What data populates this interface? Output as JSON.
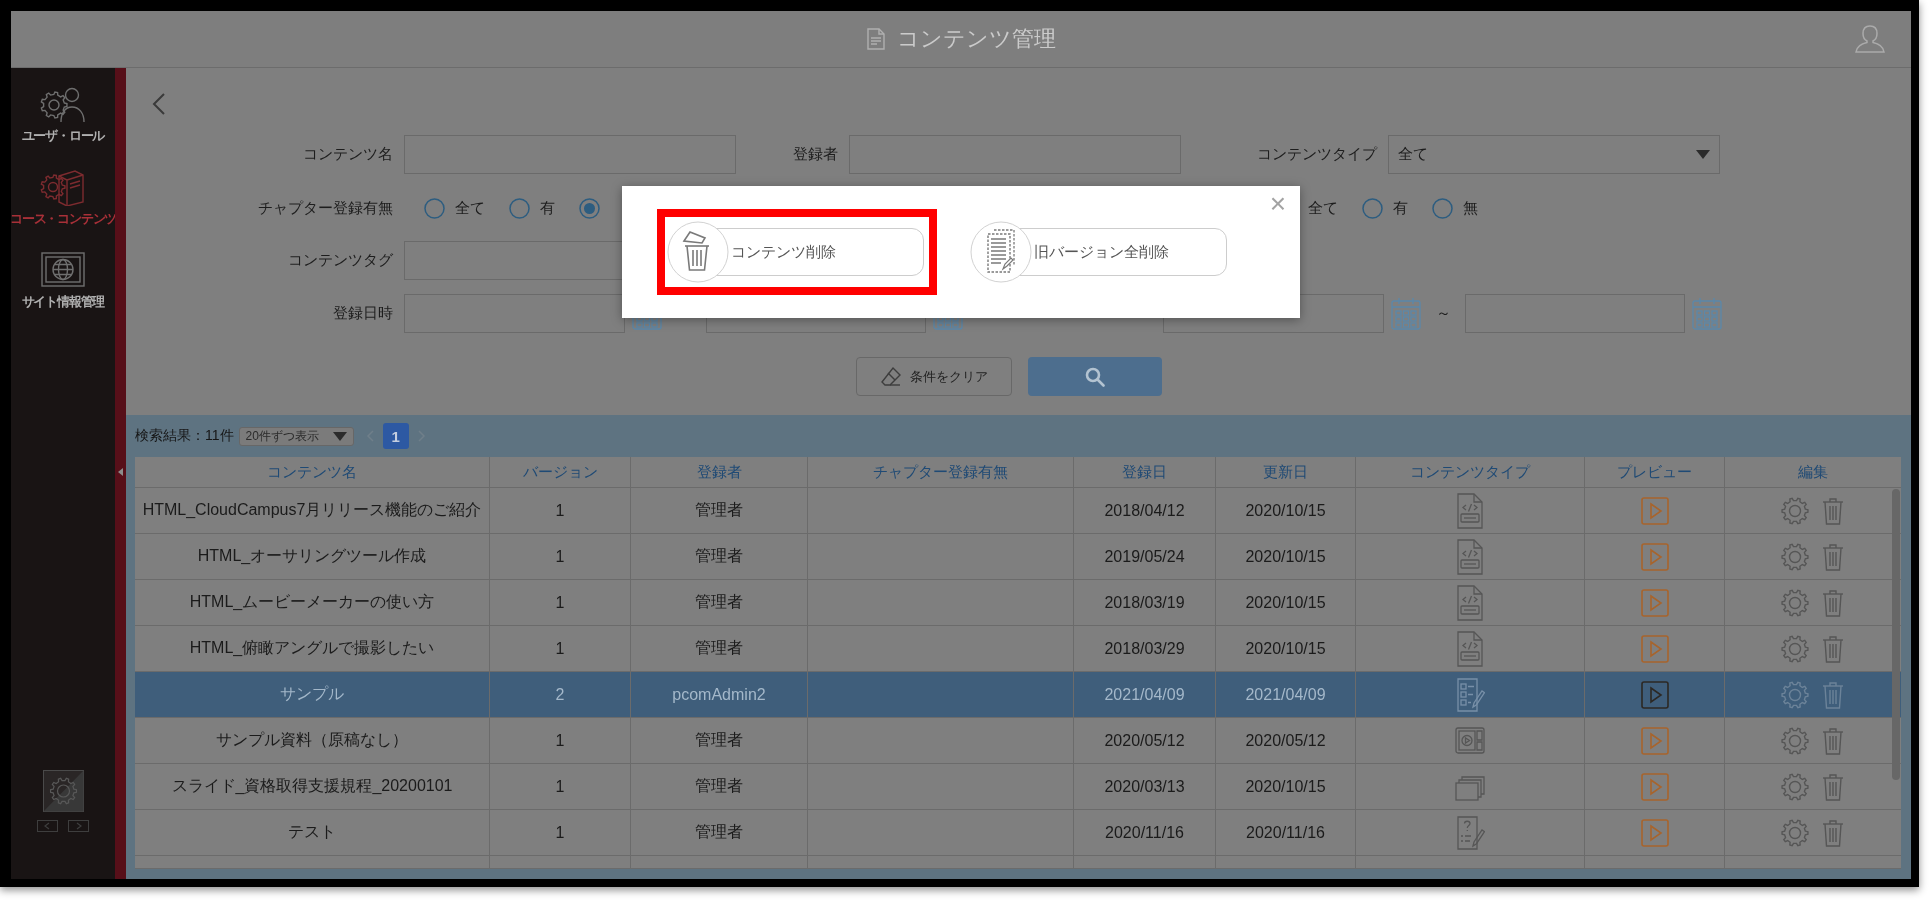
{
  "header": {
    "title": "コンテンツ管理"
  },
  "sidebar": {
    "items": [
      {
        "label": "ユーザ・ロール",
        "kind": "users",
        "selected": false
      },
      {
        "label": "コース・コンテンツ",
        "kind": "courses",
        "selected": true
      },
      {
        "label": "サイト情報管理",
        "kind": "site",
        "selected": false
      }
    ]
  },
  "filters": {
    "rows": [
      [
        {
          "kind": "text",
          "label": "コンテンツ名"
        },
        {
          "kind": "text",
          "label": "登録者"
        },
        {
          "kind": "select",
          "label": "コンテンツタイプ",
          "value": "全て"
        }
      ],
      [
        {
          "kind": "radio",
          "label": "チャプター登録有無",
          "options": [
            {
              "label": "全て",
              "selected": false
            },
            {
              "label": "有",
              "selected": false
            },
            {
              "selected": true
            }
          ]
        },
        {
          "kind": "radio",
          "options": [
            {
              "label": "全て"
            },
            {
              "label": "有",
              "selected": false
            },
            {
              "label": "無",
              "selected": false
            }
          ]
        }
      ],
      [
        {
          "kind": "text",
          "label": "コンテンツタグ"
        }
      ],
      [
        {
          "kind": "date_range",
          "label": "登録日時"
        },
        {
          "kind": "date_range",
          "separator": "～"
        }
      ]
    ],
    "buttons": [
      {
        "kind": "clear",
        "label": "条件をクリア"
      },
      {
        "kind": "search"
      }
    ]
  },
  "results": {
    "count": "検索結果：11件",
    "page_size": "20件ずつ表示",
    "pagination": {
      "prev_disabled": true,
      "next_disabled": true,
      "pages": [
        {
          "label": "1",
          "selected": true
        }
      ]
    },
    "table": {
      "columns": [
        "コンテンツ名",
        "バージョン",
        "登録者",
        "チャプター登録有無",
        "登録日",
        "更新日",
        "コンテンツタイプ",
        "プレビュー",
        "編集"
      ],
      "rows": [
        {
          "name": "HTML_CloudCampus7月リリース機能のご紹介",
          "version": "1",
          "author": "管理者",
          "registered": "2018/04/12",
          "updated": "2020/10/15",
          "kind": "html",
          "selected": false
        },
        {
          "name": "HTML_オーサリングツール作成",
          "version": "1",
          "author": "管理者",
          "registered": "2019/05/24",
          "updated": "2020/10/15",
          "kind": "html",
          "selected": false
        },
        {
          "name": "HTML_ムービーメーカーの使い方",
          "version": "1",
          "author": "管理者",
          "registered": "2018/03/19",
          "updated": "2020/10/15",
          "kind": "html",
          "selected": false
        },
        {
          "name": "HTML_俯瞰アングルで撮影したい",
          "version": "1",
          "author": "管理者",
          "registered": "2018/03/29",
          "updated": "2020/10/15",
          "kind": "html",
          "selected": false
        },
        {
          "name": "サンプル",
          "version": "2",
          "author": "pcomAdmin2",
          "registered": "2021/04/09",
          "updated": "2021/04/09",
          "kind": "survey",
          "selected": true
        },
        {
          "name": "サンプル資料（原稿なし）",
          "version": "1",
          "author": "管理者",
          "registered": "2020/05/12",
          "updated": "2020/05/12",
          "kind": "video",
          "selected": false
        },
        {
          "name": "スライド_資格取得支援規程_20200101",
          "version": "1",
          "author": "管理者",
          "registered": "2020/03/13",
          "updated": "2020/10/15",
          "kind": "slides",
          "selected": false
        },
        {
          "name": "テスト",
          "version": "1",
          "author": "管理者",
          "registered": "2020/11/16",
          "updated": "2020/11/16",
          "kind": "quiz",
          "selected": false
        }
      ]
    }
  },
  "dialog": {
    "close": "×",
    "buttons": [
      {
        "label": "コンテンツ削除",
        "kind": "delete",
        "highlighted": true
      },
      {
        "label": "旧バージョン全削除",
        "kind": "delete_old",
        "highlighted": false
      }
    ]
  }
}
